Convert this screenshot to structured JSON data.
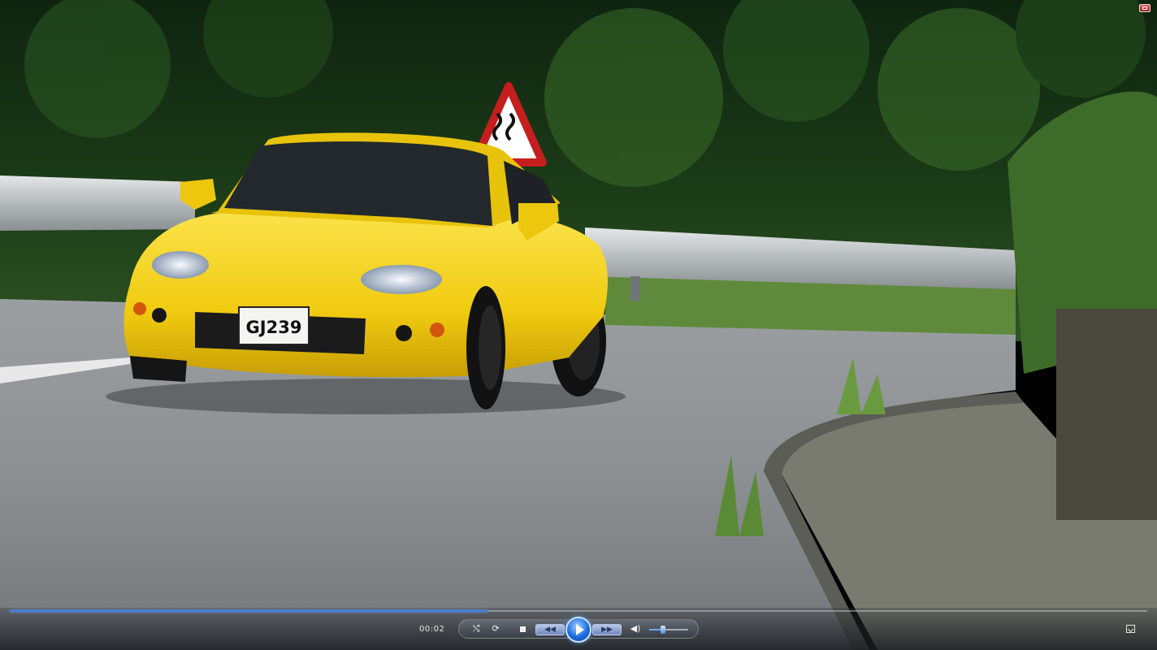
{
  "video": {
    "plate_text": "GJ239"
  },
  "player": {
    "time": "00:02",
    "progress": 0.42,
    "volume": 0.35,
    "icons": {
      "shuffle": "shuffle-icon",
      "repeat": "repeat-icon",
      "stop": "stop-icon",
      "previous": "previous-icon",
      "play": "play-icon",
      "next": "next-icon",
      "mute": "speaker-icon",
      "fullscreen": "fullscreen-icon",
      "restore": "restore-icon"
    },
    "colors": {
      "accent": "#3d7fe8",
      "car": "#f2cf12"
    }
  }
}
